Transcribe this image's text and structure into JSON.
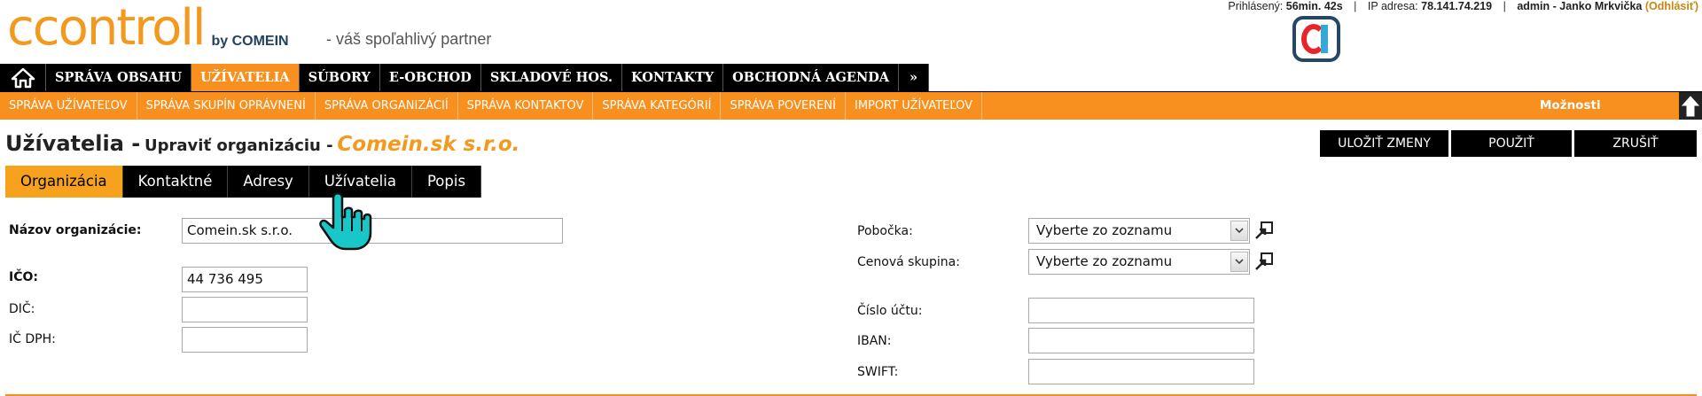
{
  "header": {
    "logo_text": "ccontroll",
    "logo_by": "by COMEIN",
    "slogan": "- váš spoľahlivý partner",
    "user_info": {
      "logged_label": "Prihlásený:",
      "logged_time": "56min. 42s",
      "ip_label": "IP adresa:",
      "ip_value": "78.141.74.219",
      "user": "admin - Janko Mrkvička",
      "logout": "(Odhlásiť)"
    }
  },
  "mainnav": {
    "items": [
      {
        "label": "SPRÁVA OBSAHU"
      },
      {
        "label": "UŽÍVATELIA"
      },
      {
        "label": "SÚBORY"
      },
      {
        "label": "E-OBCHOD"
      },
      {
        "label": "SKLADOVÉ HOS."
      },
      {
        "label": "KONTAKTY"
      },
      {
        "label": "OBCHODNÁ AGENDA"
      }
    ],
    "more": "»",
    "active_index": 1
  },
  "subnav": {
    "items": [
      {
        "label": "SPRÁVA UŽÍVATEĽOV"
      },
      {
        "label": "SPRÁVA SKUPÍN OPRÁVNENÍ"
      },
      {
        "label": "SPRÁVA ORGANIZÁCIÍ"
      },
      {
        "label": "SPRÁVA KONTAKTOV"
      },
      {
        "label": "SPRÁVA KATEGÓRIÍ"
      },
      {
        "label": "SPRÁVA POVERENÍ"
      },
      {
        "label": "IMPORT UŽÍVATEĽOV"
      }
    ],
    "options_label": "Možnosti"
  },
  "page": {
    "title_main": "Užívatelia -",
    "title_action": "Upraviť organizáciu -",
    "title_entity": "Comein.sk s.r.o."
  },
  "actions": {
    "save": "ULOŽIŤ ZMENY",
    "apply": "POUŽIŤ",
    "cancel": "ZRUŠIŤ"
  },
  "tabs": [
    {
      "label": "Organizácia"
    },
    {
      "label": "Kontaktné"
    },
    {
      "label": "Adresy"
    },
    {
      "label": "Užívatelia"
    },
    {
      "label": "Popis"
    }
  ],
  "form": {
    "name_label": "Názov organizácie:",
    "name_value": "Comein.sk s.r.o.",
    "ico_label": "IČO:",
    "ico_value": "44 736 495",
    "dic_label": "DIČ:",
    "dic_value": "",
    "icdph_label": "IČ DPH:",
    "icdph_value": "",
    "branch_label": "Pobočka:",
    "branch_value": "Vyberte zo zoznamu",
    "price_group_label": "Cenová skupina:",
    "price_group_value": "Vyberte zo zoznamu",
    "account_label": "Číslo účtu:",
    "account_value": "",
    "iban_label": "IBAN:",
    "iban_value": "",
    "swift_label": "SWIFT:",
    "swift_value": ""
  },
  "colors": {
    "brand_orange": "#f7901e",
    "nav_black": "#000000",
    "title_orange": "#f39a1e"
  }
}
